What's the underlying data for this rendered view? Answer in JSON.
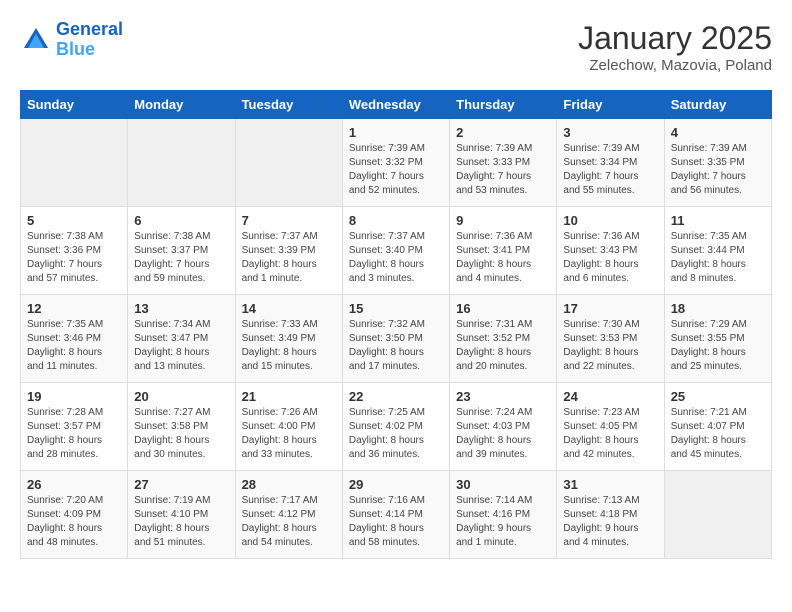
{
  "logo": {
    "line1": "General",
    "line2": "Blue"
  },
  "title": "January 2025",
  "subtitle": "Zelechow, Mazovia, Poland",
  "days_of_week": [
    "Sunday",
    "Monday",
    "Tuesday",
    "Wednesday",
    "Thursday",
    "Friday",
    "Saturday"
  ],
  "weeks": [
    [
      {
        "day": "",
        "info": ""
      },
      {
        "day": "",
        "info": ""
      },
      {
        "day": "",
        "info": ""
      },
      {
        "day": "1",
        "info": "Sunrise: 7:39 AM\nSunset: 3:32 PM\nDaylight: 7 hours and 52 minutes."
      },
      {
        "day": "2",
        "info": "Sunrise: 7:39 AM\nSunset: 3:33 PM\nDaylight: 7 hours and 53 minutes."
      },
      {
        "day": "3",
        "info": "Sunrise: 7:39 AM\nSunset: 3:34 PM\nDaylight: 7 hours and 55 minutes."
      },
      {
        "day": "4",
        "info": "Sunrise: 7:39 AM\nSunset: 3:35 PM\nDaylight: 7 hours and 56 minutes."
      }
    ],
    [
      {
        "day": "5",
        "info": "Sunrise: 7:38 AM\nSunset: 3:36 PM\nDaylight: 7 hours and 57 minutes."
      },
      {
        "day": "6",
        "info": "Sunrise: 7:38 AM\nSunset: 3:37 PM\nDaylight: 7 hours and 59 minutes."
      },
      {
        "day": "7",
        "info": "Sunrise: 7:37 AM\nSunset: 3:39 PM\nDaylight: 8 hours and 1 minute."
      },
      {
        "day": "8",
        "info": "Sunrise: 7:37 AM\nSunset: 3:40 PM\nDaylight: 8 hours and 3 minutes."
      },
      {
        "day": "9",
        "info": "Sunrise: 7:36 AM\nSunset: 3:41 PM\nDaylight: 8 hours and 4 minutes."
      },
      {
        "day": "10",
        "info": "Sunrise: 7:36 AM\nSunset: 3:43 PM\nDaylight: 8 hours and 6 minutes."
      },
      {
        "day": "11",
        "info": "Sunrise: 7:35 AM\nSunset: 3:44 PM\nDaylight: 8 hours and 8 minutes."
      }
    ],
    [
      {
        "day": "12",
        "info": "Sunrise: 7:35 AM\nSunset: 3:46 PM\nDaylight: 8 hours and 11 minutes."
      },
      {
        "day": "13",
        "info": "Sunrise: 7:34 AM\nSunset: 3:47 PM\nDaylight: 8 hours and 13 minutes."
      },
      {
        "day": "14",
        "info": "Sunrise: 7:33 AM\nSunset: 3:49 PM\nDaylight: 8 hours and 15 minutes."
      },
      {
        "day": "15",
        "info": "Sunrise: 7:32 AM\nSunset: 3:50 PM\nDaylight: 8 hours and 17 minutes."
      },
      {
        "day": "16",
        "info": "Sunrise: 7:31 AM\nSunset: 3:52 PM\nDaylight: 8 hours and 20 minutes."
      },
      {
        "day": "17",
        "info": "Sunrise: 7:30 AM\nSunset: 3:53 PM\nDaylight: 8 hours and 22 minutes."
      },
      {
        "day": "18",
        "info": "Sunrise: 7:29 AM\nSunset: 3:55 PM\nDaylight: 8 hours and 25 minutes."
      }
    ],
    [
      {
        "day": "19",
        "info": "Sunrise: 7:28 AM\nSunset: 3:57 PM\nDaylight: 8 hours and 28 minutes."
      },
      {
        "day": "20",
        "info": "Sunrise: 7:27 AM\nSunset: 3:58 PM\nDaylight: 8 hours and 30 minutes."
      },
      {
        "day": "21",
        "info": "Sunrise: 7:26 AM\nSunset: 4:00 PM\nDaylight: 8 hours and 33 minutes."
      },
      {
        "day": "22",
        "info": "Sunrise: 7:25 AM\nSunset: 4:02 PM\nDaylight: 8 hours and 36 minutes."
      },
      {
        "day": "23",
        "info": "Sunrise: 7:24 AM\nSunset: 4:03 PM\nDaylight: 8 hours and 39 minutes."
      },
      {
        "day": "24",
        "info": "Sunrise: 7:23 AM\nSunset: 4:05 PM\nDaylight: 8 hours and 42 minutes."
      },
      {
        "day": "25",
        "info": "Sunrise: 7:21 AM\nSunset: 4:07 PM\nDaylight: 8 hours and 45 minutes."
      }
    ],
    [
      {
        "day": "26",
        "info": "Sunrise: 7:20 AM\nSunset: 4:09 PM\nDaylight: 8 hours and 48 minutes."
      },
      {
        "day": "27",
        "info": "Sunrise: 7:19 AM\nSunset: 4:10 PM\nDaylight: 8 hours and 51 minutes."
      },
      {
        "day": "28",
        "info": "Sunrise: 7:17 AM\nSunset: 4:12 PM\nDaylight: 8 hours and 54 minutes."
      },
      {
        "day": "29",
        "info": "Sunrise: 7:16 AM\nSunset: 4:14 PM\nDaylight: 8 hours and 58 minutes."
      },
      {
        "day": "30",
        "info": "Sunrise: 7:14 AM\nSunset: 4:16 PM\nDaylight: 9 hours and 1 minute."
      },
      {
        "day": "31",
        "info": "Sunrise: 7:13 AM\nSunset: 4:18 PM\nDaylight: 9 hours and 4 minutes."
      },
      {
        "day": "",
        "info": ""
      }
    ]
  ]
}
